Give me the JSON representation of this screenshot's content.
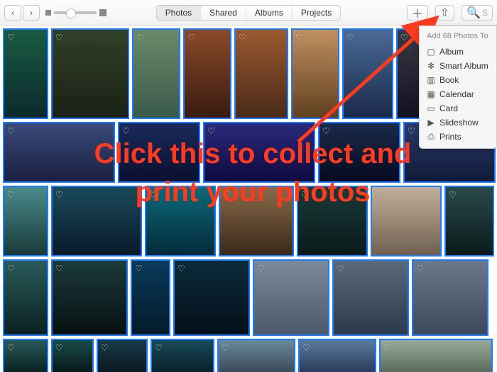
{
  "toolbar": {
    "tabs": [
      "Photos",
      "Shared",
      "Albums",
      "Projects"
    ],
    "active_tab_index": 0,
    "search_placeholder": "S"
  },
  "dropdown": {
    "header": "Add 68 Photos To",
    "items": [
      {
        "icon": "album",
        "label": "Album"
      },
      {
        "icon": "smart",
        "label": "Smart Album"
      },
      {
        "icon": "book",
        "label": "Book"
      },
      {
        "icon": "calendar",
        "label": "Calendar"
      },
      {
        "icon": "card",
        "label": "Card"
      },
      {
        "icon": "slideshow",
        "label": "Slideshow"
      },
      {
        "icon": "prints",
        "label": "Prints"
      }
    ]
  },
  "annotation": {
    "text_line1": "Click this to collect and",
    "text_line2": "print your photos",
    "color": "#ff3b1f"
  },
  "grid": {
    "selection_color": "#1d7bff",
    "rows": [
      [
        {
          "w": 64,
          "h": 128,
          "bg": "linear-gradient(#1a5a44,#0a2a2a)"
        },
        {
          "w": 110,
          "h": 128,
          "bg": "linear-gradient(#304028,#1a2015)"
        },
        {
          "w": 68,
          "h": 128,
          "bg": "linear-gradient(#6a8a6a,#3a5a4a)"
        },
        {
          "w": 68,
          "h": 128,
          "bg": "linear-gradient(#8a4a28,#3a1a10)"
        },
        {
          "w": 76,
          "h": 128,
          "bg": "linear-gradient(#9a5a30,#4a2a18)"
        },
        {
          "w": 68,
          "h": 128,
          "bg": "linear-gradient(#c09060,#604020)"
        },
        {
          "w": 72,
          "h": 128,
          "bg": "linear-gradient(#4a6a96,#1a2a4a)"
        },
        {
          "w": 72,
          "h": 128,
          "bg": "linear-gradient(#3a3a46,#101020)"
        },
        {
          "w": 68,
          "h": 128,
          "bg": "linear-gradient(#2a4a5a,#0a1a2a)"
        }
      ],
      [
        {
          "w": 158,
          "h": 86,
          "bg": "linear-gradient(#3a4a7a,#1a2040)"
        },
        {
          "w": 116,
          "h": 86,
          "bg": "linear-gradient(#1a2a5a,#0a1030)"
        },
        {
          "w": 158,
          "h": 86,
          "bg": "linear-gradient(#2a2a7a,#100a40)"
        },
        {
          "w": 116,
          "h": 86,
          "bg": "linear-gradient(#1a2a4a,#050a20)"
        },
        {
          "w": 130,
          "h": 86,
          "bg": "linear-gradient(#2a3a6a,#101a3a)"
        }
      ],
      [
        {
          "w": 64,
          "h": 100,
          "bg": "linear-gradient(#4a8a8a,#1a3a3a)"
        },
        {
          "w": 128,
          "h": 100,
          "bg": "linear-gradient(#1a4a5a,#081a2a)"
        },
        {
          "w": 100,
          "h": 100,
          "bg": "linear-gradient(#0a6a7a,#042a3a)"
        },
        {
          "w": 106,
          "h": 100,
          "bg": "linear-gradient(#8a6a4a,#3a2a1a)"
        },
        {
          "w": 100,
          "h": 100,
          "bg": "linear-gradient(#1a3a3a,#0a1a1a)"
        },
        {
          "w": 100,
          "h": 100,
          "bg": "linear-gradient(#c0b09a,#706050)"
        },
        {
          "w": 70,
          "h": 100,
          "bg": "linear-gradient(#2a4a4a,#0a1a1a)"
        }
      ],
      [
        {
          "w": 64,
          "h": 108,
          "bg": "linear-gradient(#2a5a5a,#0a2020)"
        },
        {
          "w": 108,
          "h": 108,
          "bg": "linear-gradient(#1a3a3a,#081010)"
        },
        {
          "w": 56,
          "h": 108,
          "bg": "linear-gradient(#0a3a5a,#041a2a)"
        },
        {
          "w": 108,
          "h": 108,
          "bg": "linear-gradient(#0a2a3a,#04101a)"
        },
        {
          "w": 108,
          "h": 108,
          "bg": "linear-gradient(#7a8a9a,#4a5a6a)"
        },
        {
          "w": 108,
          "h": 108,
          "bg": "linear-gradient(#5a6a7a,#2a3a4a)"
        },
        {
          "w": 108,
          "h": 108,
          "bg": "linear-gradient(#6a7a8a,#3a4a5a)"
        }
      ],
      [
        {
          "w": 64,
          "h": 50,
          "bg": "linear-gradient(#2a5a5a,#0a2020)"
        },
        {
          "w": 60,
          "h": 50,
          "bg": "linear-gradient(#1a4a4a,#081818)"
        },
        {
          "w": 72,
          "h": 50,
          "bg": "linear-gradient(#1a3a4a,#081820)"
        },
        {
          "w": 90,
          "h": 50,
          "bg": "linear-gradient(#1a4a5a,#082028)"
        },
        {
          "w": 110,
          "h": 50,
          "bg": "linear-gradient(#6a8a9a,#3a4a5a)"
        },
        {
          "w": 110,
          "h": 50,
          "bg": "linear-gradient(#5a7a9a,#2a3a5a)"
        },
        {
          "w": 160,
          "h": 50,
          "bg": "linear-gradient(#9aaa9a,#5a6a5a)"
        }
      ]
    ]
  }
}
